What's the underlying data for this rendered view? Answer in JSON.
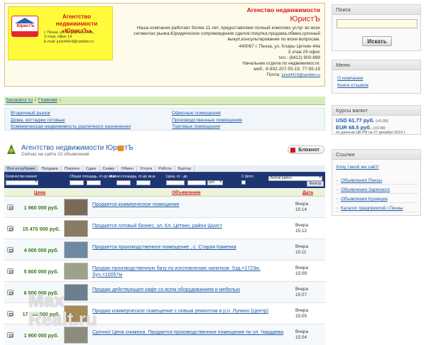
{
  "logo": {
    "title": "Агентство недвижимости «ЮристЪ»",
    "brand_word": "ЮристЪ",
    "address_lines": [
      "г. Пенза, ул. Кл. Цеткин, 44а,",
      "3 этаж, офис 14",
      "E-mail: jurist4414@rambler.ru"
    ]
  },
  "company": {
    "name": "Агенство недвижимости",
    "brand": "ЮристЪ",
    "description": "Наша компания работает более 11 лет, предоставляем полный комплекс услуг во всех сегментах рынка.Юридическое сопровождение сделок:покупка,продажа,обмен,срочный выкуп,консультирование по всем вопросам.",
    "address_lines": [
      "440067 г. Пенза, ул. Клары Цеткин 44а",
      "3 этаж 29 офис",
      "тел.: (8412) 900-899",
      "Начальник отдела по недвижимости:",
      "моб.: 8-902-207-55-19, 77-55-19"
    ],
    "email_label": "Почта:",
    "email": "jurist4414@rambler.ru"
  },
  "breadcrumb": {
    "site": "bazarpnz.ru",
    "separator": "/",
    "page": "Главная",
    "arrow": "›"
  },
  "nav": {
    "left": [
      "Вторичный рынок",
      "Дома, коттеджи готовые",
      "Коммерческая недвижимость различного назначения"
    ],
    "right": [
      "Офисные помещения",
      "Производственные помещения",
      "Торговые помещения"
    ]
  },
  "agency": {
    "title": "Агентство недвижимости ЮристЪ",
    "count_text": "Сейчас на сайте 23 объявлений",
    "notebook_label": "Блокнот"
  },
  "tabs": [
    "Все из рубрики",
    "Продажа",
    "Покупка",
    "Сдаю",
    "Сниму",
    "Обмен",
    "Услуги",
    "Работа",
    "Бартер"
  ],
  "filters": {
    "count_rooms_label": "Количество комнат",
    "total_area_label": "Общая площадь, от-до кв.м.",
    "living_area_label": "Жилая площадь, от-до кв.м.",
    "price_label": "Цена, от - до",
    "photo_label": "С фото",
    "district_value": "Любой район",
    "currency_value": "руб.",
    "button_label": "Фильтр"
  },
  "table": {
    "headers": {
      "price": "Цена",
      "ad": "Объявление",
      "date": "Дата"
    },
    "rows": [
      {
        "price": "1 960 000 руб.",
        "title": "Продается коммерческое помещение",
        "day": "Вчера",
        "time": "15:14",
        "thumb_color": "#7a6a58"
      },
      {
        "price": "15 470 000 руб.",
        "title": "Продается готовый бизнес, ул. Кл. Цеткин, район Шуист",
        "day": "Вчера",
        "time": "15:12",
        "thumb_color": "#8a7a66"
      },
      {
        "price": "4 000 000 руб.",
        "title": "Продается производственное помещение , с. Старая Каменка",
        "day": "Вчера",
        "time": "15:11",
        "thumb_color": "#6d8aa2"
      },
      {
        "price": "5 800 000 руб.",
        "title": "Продаю производственную базу по изготовлению напитков. Sзд.=1723м. Sуч.=10057м",
        "day": "Вчера",
        "time": "15:09",
        "thumb_color": "#9aa38a"
      },
      {
        "price": "6 500 000 руб.",
        "title": "Продаю действующее кафе со всем оборудованием и мебелью",
        "day": "Вчера",
        "time": "15:07",
        "thumb_color": "#6d7f8e"
      },
      {
        "price": "17 000 000 руб.",
        "title": "Продаю коммерческое помещение с новым ремонтом в р.п. Лунино (Центр)",
        "day": "Вчера",
        "time": "15:05",
        "thumb_color": "#a88a5a"
      },
      {
        "price": "1 900 000 руб.",
        "title": "Срочно! Цена снижена. Продается производственное помещение по ул. Чаадаева",
        "day": "Вчера",
        "time": "15:04",
        "thumb_color": "#8c8c7e"
      }
    ]
  },
  "sidebar": {
    "search": {
      "title": "Поиск",
      "placeholder": "",
      "button": "Искать"
    },
    "menu": {
      "title": "Меню",
      "items": [
        "О компании",
        "Книга отзывов"
      ]
    },
    "rates": {
      "title": "Курсы валют",
      "usd": {
        "code": "USD",
        "value": "61.77 руб.",
        "delta": "(+0.05)"
      },
      "eur": {
        "code": "EUR",
        "value": "68.5 руб.",
        "delta": "(+0.09)"
      },
      "note": "по данным ЦБ РФ на 27 декабря 2019 г."
    },
    "links": {
      "title": "Ссылки",
      "want_site": "Хочу такой же сайт!",
      "items": [
        "Объявления Пензы",
        "Объявления Заречного",
        "Объявления Кузнецка",
        "Каталог предприятий г.Пензы"
      ]
    }
  },
  "watermark": {
    "line1": "Max",
    "line2": "Realt.ru"
  }
}
